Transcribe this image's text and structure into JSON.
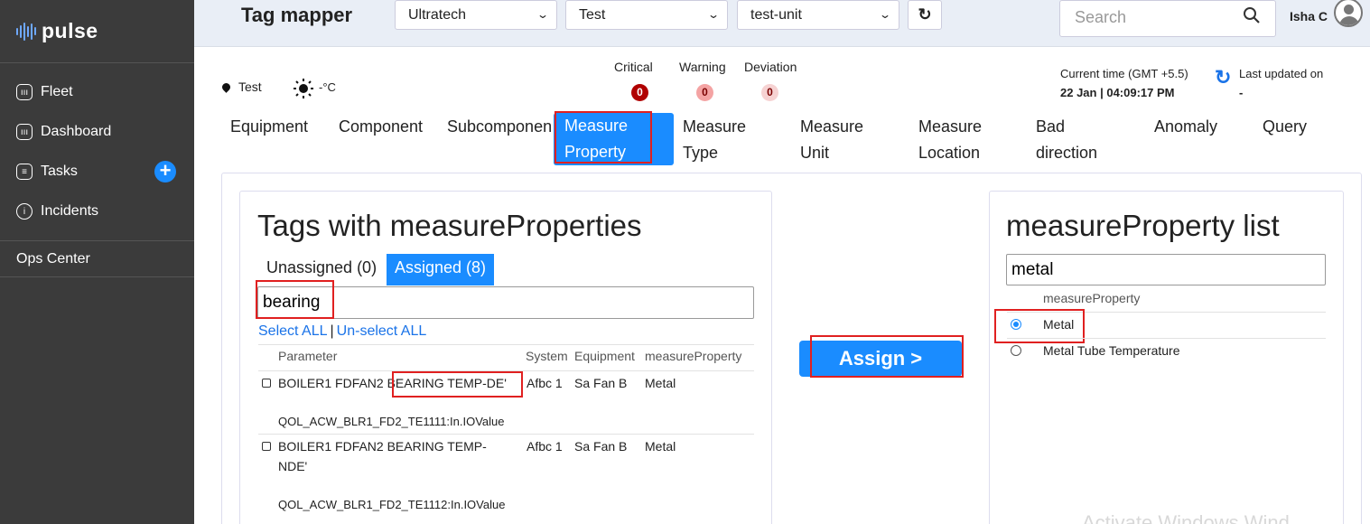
{
  "app": {
    "logo": "pulse",
    "title": "Tag mapper"
  },
  "sidebar": {
    "items": [
      {
        "label": "Fleet",
        "icon": "fleet-icon"
      },
      {
        "label": "Dashboard",
        "icon": "dashboard-icon"
      },
      {
        "label": "Tasks",
        "icon": "tasks-icon",
        "action_icon": "plus-icon"
      },
      {
        "label": "Incidents",
        "icon": "info-icon"
      }
    ],
    "ops_center": "Ops Center"
  },
  "header": {
    "selects": [
      "Ultratech",
      "Test",
      "test-unit"
    ],
    "search_placeholder": "Search",
    "user": "Isha C"
  },
  "info": {
    "location": "Test",
    "temperature": "-°C",
    "alerts": [
      {
        "label": "Critical",
        "count": "0",
        "color": "#b00000"
      },
      {
        "label": "Warning",
        "count": "0",
        "color": "#f4a3a3"
      },
      {
        "label": "Deviation",
        "count": "0",
        "color": "#f6d2d2"
      }
    ],
    "current_time_label": "Current time (GMT +5.5)",
    "current_time": "22 Jan | 04:09:17 PM",
    "last_updated_label": "Last updated on",
    "last_updated": "-"
  },
  "tabs": [
    {
      "line1": "Equipment",
      "line2": ""
    },
    {
      "line1": "Component",
      "line2": ""
    },
    {
      "line1": "Subcomponen",
      "line2": ""
    },
    {
      "line1": "Measure",
      "line2": "Property",
      "active": true
    },
    {
      "line1": "Measure",
      "line2": "Type"
    },
    {
      "line1": "Measure",
      "line2": "Unit"
    },
    {
      "line1": "Measure",
      "line2": "Location"
    },
    {
      "line1": "Bad",
      "line2": "direction"
    },
    {
      "line1": "Anomaly",
      "line2": ""
    },
    {
      "line1": "Query",
      "line2": ""
    }
  ],
  "left_panel": {
    "title": "Tags with measureProperties",
    "subtabs": [
      "Unassigned (0)",
      "Assigned (8)"
    ],
    "filter_value": "bearing",
    "select_all": "Select ALL",
    "separator": "|",
    "unselect_all": "Un-select ALL",
    "columns": [
      "Parameter",
      "System",
      "Equipment",
      "measureProperty"
    ],
    "rows": [
      {
        "param_prefix": "BOILER1 FDFAN2 ",
        "param_highlight": "BEARING TEMP-DE'",
        "param_line2": "",
        "tag": "QOL_ACW_BLR1_FD2_TE1111:In.IOValue",
        "system": "Afbc 1",
        "equipment": "Sa Fan B",
        "measure_property": "Metal"
      },
      {
        "param_prefix": "BOILER1 FDFAN2 BEARING TEMP-",
        "param_highlight": "",
        "param_line2": "NDE'",
        "tag": "QOL_ACW_BLR1_FD2_TE1112:In.IOValue",
        "system": "Afbc 1",
        "equipment": "Sa Fan B",
        "measure_property": "Metal"
      }
    ]
  },
  "assign_button": "Assign >",
  "right_panel": {
    "title": "measureProperty list",
    "filter_value": "metal",
    "column": "measureProperty",
    "options": [
      {
        "label": "Metal",
        "selected": true
      },
      {
        "label": "Metal Tube Temperature",
        "selected": false
      }
    ]
  },
  "watermark": "Activate Windows Wind"
}
